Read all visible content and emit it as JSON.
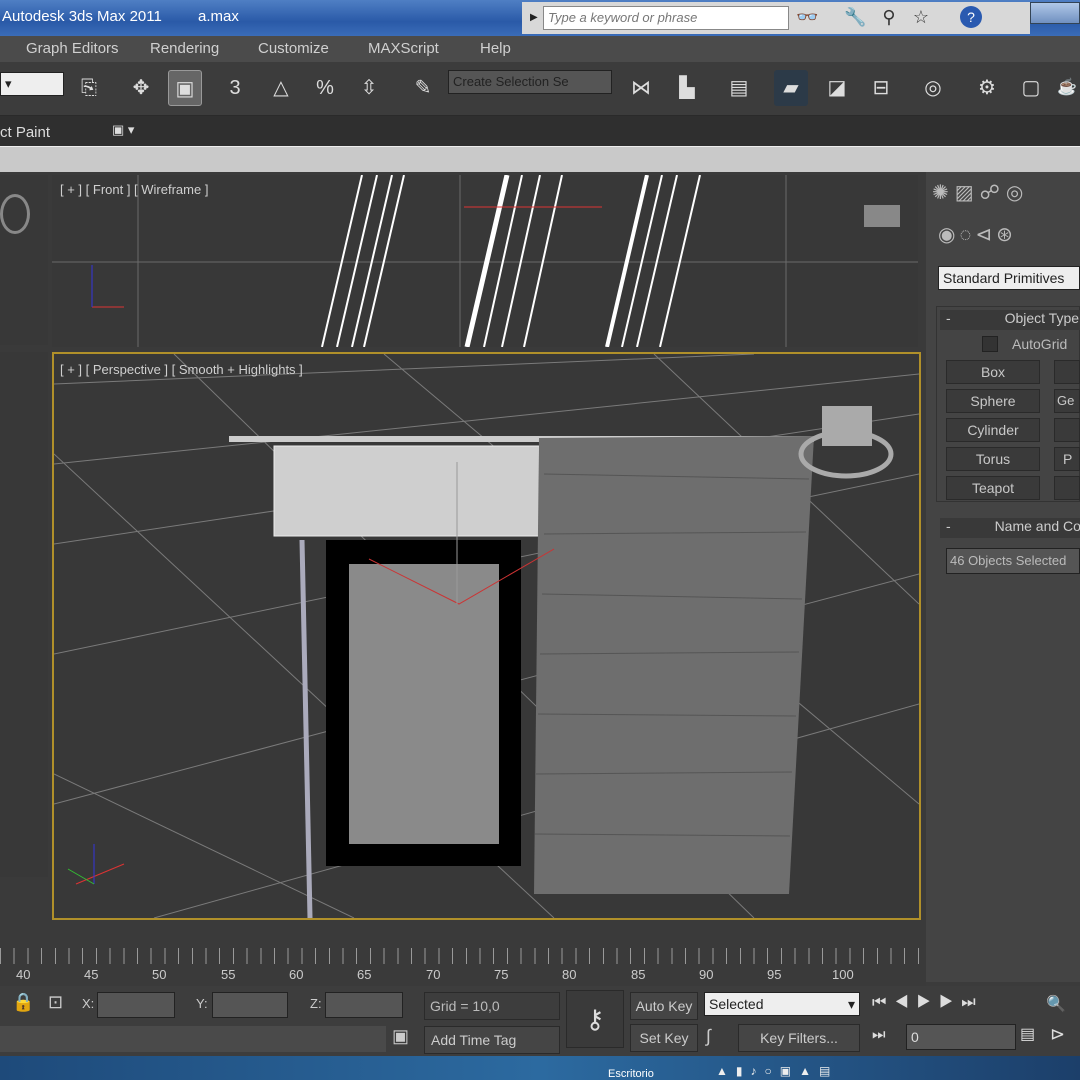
{
  "title_bar": {
    "app": "Autodesk 3ds Max  2011",
    "file": "a.max",
    "search_placeholder": "Type a keyword or phrase"
  },
  "menu": [
    "Graph Editors",
    "Rendering",
    "Customize",
    "MAXScript",
    "Help"
  ],
  "toolbar": {
    "selection_set_placeholder": "Create Selection Se",
    "numeric_3": "3",
    "percent": "%"
  },
  "ribbon": {
    "label": "ct Paint"
  },
  "viewports": {
    "front": "[ + ] [ Front ] [ Wireframe ]",
    "perspective": "[ + ] [ Perspective ] [ Smooth + Highlights ]"
  },
  "command_panel": {
    "dropdown": "Standard Primitives",
    "object_type": "Object Type",
    "autogrid": "AutoGrid",
    "buttons": [
      "Box",
      "Sphere",
      "Cylinder",
      "Torus",
      "Teapot"
    ],
    "buttons_right": [
      "",
      "Ge",
      "",
      "P",
      ""
    ],
    "name_color": "Name and Co",
    "name_field": "46 Objects Selected"
  },
  "timeline": {
    "ticks": [
      "40",
      "45",
      "50",
      "55",
      "60",
      "65",
      "70",
      "75",
      "80",
      "85",
      "90",
      "95",
      "100"
    ]
  },
  "status": {
    "x_label": "X:",
    "y_label": "Y:",
    "z_label": "Z:",
    "grid": "Grid = 10,0",
    "add_time_tag": "Add Time Tag",
    "auto_key": "Auto Key",
    "set_key": "Set Key",
    "key_mode": "Selected",
    "key_filters": "Key Filters...",
    "frame": "0"
  },
  "taskbar": {
    "label": "Escritorio"
  },
  "colors": {
    "active_viewport_border": "#b0902a",
    "titlebar": "#2a5aa8"
  }
}
